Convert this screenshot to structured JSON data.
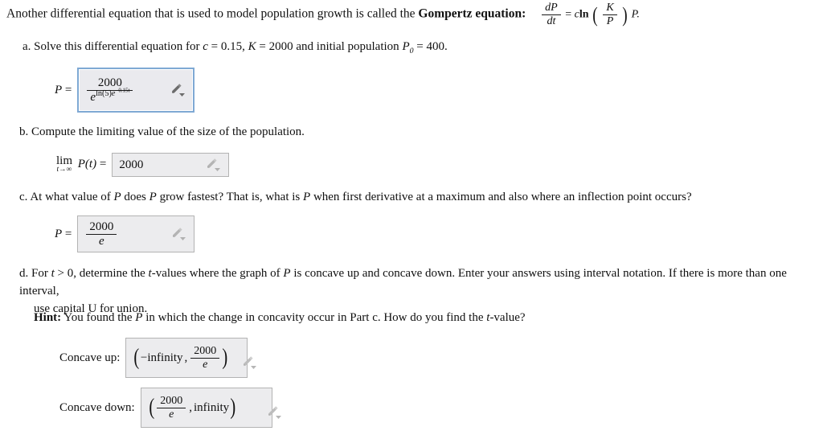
{
  "intro": {
    "text_before": "Another differential equation that is used to model population growth is called the ",
    "bold_term": "Gompertz equation:",
    "equation": {
      "lhs_num": "dP",
      "lhs_den": "dt",
      "equals": "=",
      "coefficient": "c",
      "function": "ln",
      "inner_num": "K",
      "inner_den": "P",
      "trailing": "P."
    }
  },
  "questions": {
    "a": "a. Solve this differential equation for c = 0.15, K = 2000 and initial population P0 = 400.",
    "a_parts": {
      "prefix": "a. Solve this differential equation for ",
      "c_var": "c",
      "c_val": " = 0.15, ",
      "K_var": "K",
      "K_val": " = 2000 and initial population ",
      "P_var": "P",
      "P_sub": "0",
      "P_val": " = 400."
    },
    "b": "b. Compute the limiting value of the size of the population.",
    "c": "c. At what value of P does P grow fastest? That is, what is P when first derivative at a maximum and also where an inflection point occurs?",
    "c_parts": {
      "p1": "c. At what value of ",
      "v1": "P",
      "p2": " does ",
      "v2": "P",
      "p3": " grow fastest? That is, what is ",
      "v3": "P",
      "p4": " when first derivative at a maximum and also where an inflection point occurs?"
    },
    "d_line1": "d. For t > 0, determine the t-values where the graph of P is concave up and concave down. Enter your answers using interval notation. If there is more than one interval,",
    "d_line2": "use capital U for union.",
    "d_parts": {
      "p1": "d. For ",
      "v1": "t",
      "p2": " > 0, determine the ",
      "v2": "t",
      "p3": "-values where the graph of ",
      "v3": "P",
      "p4": " is concave up and concave down. Enter your answers using interval notation. If there is more than one interval,"
    },
    "hint_label": "Hint:",
    "hint_parts": {
      "p1": " You found the ",
      "v1": "P",
      "p2": " in which the change in concavity occur in Part c. How do you find the ",
      "v2": "t",
      "p3": "-value?"
    }
  },
  "answers": {
    "a": {
      "label_var": "P",
      "label_eq": "=",
      "value_text": "2000 / e^(ln(5)e^(-0.15t))",
      "numerator": "2000",
      "den_base": "e",
      "den_exp_ln": "ln",
      "den_exp_arg": "(5)",
      "den_exp_e": "e",
      "den_exp_e_power": "−0.15t",
      "icon": "pencil-icon",
      "focused": true
    },
    "b": {
      "lim_top": "lim",
      "lim_bot": "t→∞",
      "lim_fn": "P(t)",
      "label_eq": "=",
      "value_text": "2000",
      "icon": "pencil-icon",
      "focused": false
    },
    "c": {
      "label_var": "P",
      "label_eq": "=",
      "value_text": "2000 / e",
      "numerator": "2000",
      "denominator": "e",
      "icon": "pencil-icon",
      "focused": false
    },
    "concave_up": {
      "label": "Concave up:",
      "value_text": "(-infinity, 2000/e)",
      "open_paren": "(",
      "left_term": "−infinity",
      "comma": ",",
      "right_num": "2000",
      "right_den": "e",
      "close_paren": ")",
      "icon": "pencil-icon",
      "focused": false
    },
    "concave_down": {
      "label": "Concave down:",
      "value_text": "(2000/e, infinity)",
      "open_paren": "(",
      "left_num": "2000",
      "left_den": "e",
      "comma": ",",
      "right_term": "infinity",
      "close_paren": ")",
      "icon": "pencil-icon",
      "focused": false
    }
  },
  "colors": {
    "page_background": "#ffffff",
    "text": "#101010",
    "input_fill": "#ececee",
    "input_border": "#b3b3b3",
    "focused_border": "#7fa9d4",
    "icon_gray": "#9a9a9a",
    "icon_dark": "#6c6c6c"
  }
}
